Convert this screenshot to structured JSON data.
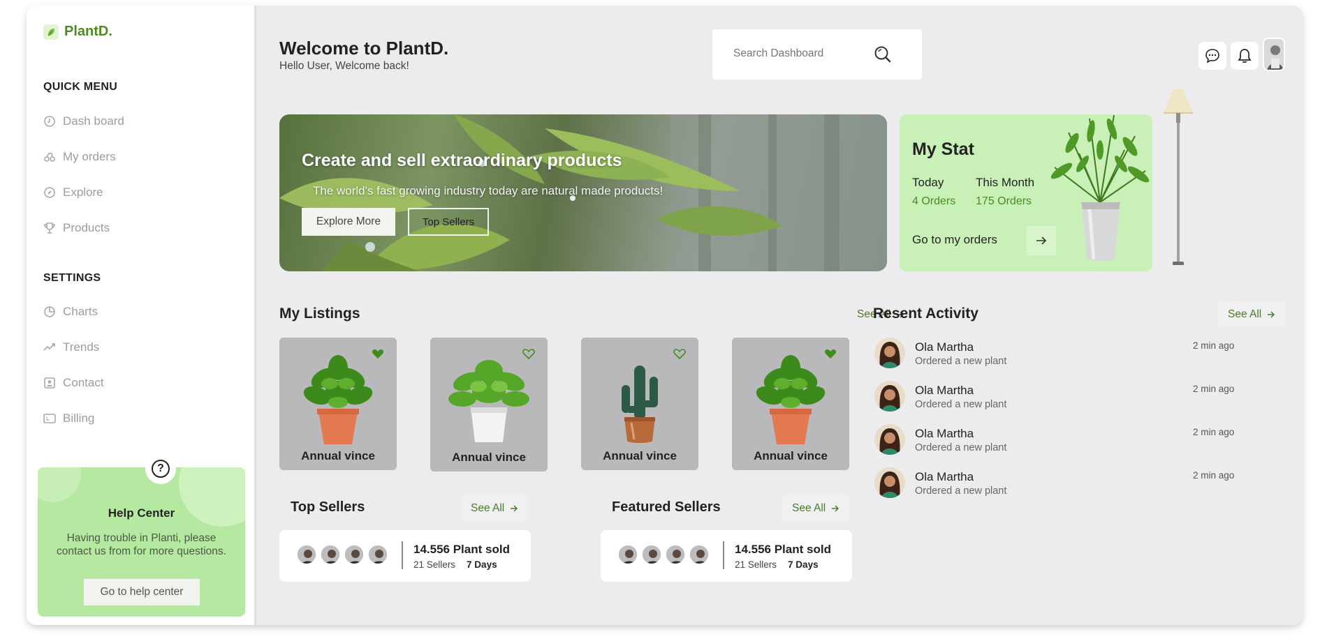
{
  "brand": {
    "name": "PlantD."
  },
  "sidebar": {
    "quick_menu_title": "QUICK MENU",
    "quick_menu": [
      {
        "label": "Dash board",
        "icon": "clock-icon"
      },
      {
        "label": "My orders",
        "icon": "orders-icon"
      },
      {
        "label": "Explore",
        "icon": "compass-icon"
      },
      {
        "label": "Products",
        "icon": "trophy-icon"
      }
    ],
    "settings_title": "SETTINGS",
    "settings": [
      {
        "label": "Charts",
        "icon": "pie-chart-icon"
      },
      {
        "label": "Trends",
        "icon": "trend-icon"
      },
      {
        "label": "Contact",
        "icon": "contact-icon"
      },
      {
        "label": "Billing",
        "icon": "billing-icon"
      }
    ],
    "help": {
      "icon": "question-icon",
      "title": "Help Center",
      "text": "Having trouble in Planti, please contact us from for more questions.",
      "button": "Go to help center"
    }
  },
  "header": {
    "title": "Welcome to PlantD.",
    "subtitle": "Hello User, Welcome back!",
    "search_placeholder": "Search Dashboard",
    "icons": [
      "chat-icon",
      "bell-icon",
      "avatar"
    ]
  },
  "hero": {
    "title": "Create and sell extraordinary products",
    "subtitle": "The world's fast growing industry today are natural made products!",
    "primary_button": "Explore More",
    "secondary_button": "Top Sellers"
  },
  "stat": {
    "title": "My Stat",
    "today_label": "Today",
    "today_value": "4 Orders",
    "month_label": "This Month",
    "month_value": "175 Orders",
    "link": "Go to my orders"
  },
  "listings": {
    "title": "My Listings",
    "see_all": "See All",
    "items": [
      {
        "name": "Annual vince",
        "favorited": true,
        "plant": "leafy"
      },
      {
        "name": "Annual vince",
        "favorited": false,
        "plant": "leafy-white-pot"
      },
      {
        "name": "Annual vince",
        "favorited": false,
        "plant": "cactus"
      },
      {
        "name": "Annual vince",
        "favorited": true,
        "plant": "leafy"
      }
    ]
  },
  "top_sellers": {
    "title": "Top Sellers",
    "see_all": "See All",
    "sold": "14.556 Plant sold",
    "sellers": "21 Sellers",
    "period": "7 Days"
  },
  "featured_sellers": {
    "title": "Featured Sellers",
    "see_all": "See All",
    "sold": "14.556 Plant sold",
    "sellers": "21 Sellers",
    "period": "7 Days"
  },
  "activity": {
    "title": "Resent Activity",
    "see_all": "See All",
    "items": [
      {
        "name": "Ola Martha",
        "desc": "Ordered a new plant",
        "time": "2 min ago"
      },
      {
        "name": "Ola Martha",
        "desc": "Ordered a new plant",
        "time": "2 min ago"
      },
      {
        "name": "Ola Martha",
        "desc": "Ordered a new plant",
        "time": "2 min ago"
      },
      {
        "name": "Ola Martha",
        "desc": "Ordered a new plant",
        "time": "2 min ago"
      }
    ]
  },
  "colors": {
    "accent": "#4c8a22",
    "help_bg": "#b5e8a0",
    "stat_bg": "#c9f0b6",
    "card_bg": "#b9b9bc",
    "canvas": "#ececef"
  }
}
